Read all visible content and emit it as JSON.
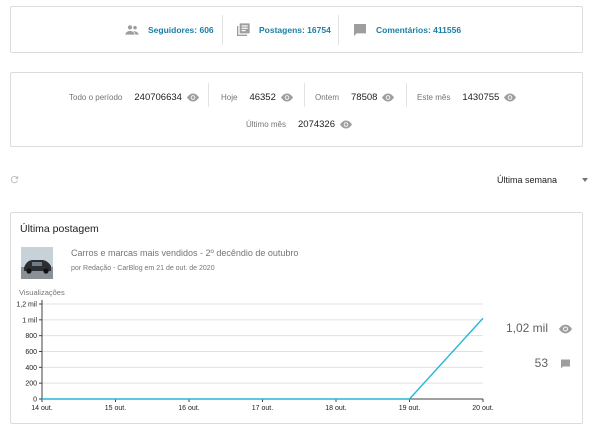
{
  "top": {
    "followers": "Seguidores: 606",
    "posts": "Postagens: 16754",
    "comments": "Comentários: 411556"
  },
  "stats": [
    {
      "label": "Todo o período",
      "value": "240706634"
    },
    {
      "label": "Hoje",
      "value": "46352"
    },
    {
      "label": "Ontem",
      "value": "78508"
    },
    {
      "label": "Este mês",
      "value": "1430755"
    },
    {
      "label": "Último mês",
      "value": "2074326"
    }
  ],
  "toolbar": {
    "range": "Última semana",
    "refresh_icon": "refresh-icon",
    "dropdown_icon": "caret-down-icon"
  },
  "latest_post": {
    "heading": "Última postagem",
    "title": "Carros e marcas mais vendidos - 2º decêndio de outubro",
    "meta": "por Redação - CarBlog em 21 de out. de 2020",
    "views": "1,02 mil",
    "comments": "53"
  },
  "colors": {
    "accent": "#1b7ea5",
    "line": "#29b6d9",
    "axis": "#424242"
  },
  "chart_data": {
    "type": "line",
    "title": "Visualizações",
    "xlabel": "",
    "ylabel": "",
    "categories": [
      "14 out.",
      "15 out.",
      "16 out.",
      "17 out.",
      "18 out.",
      "19 out.",
      "20 out."
    ],
    "ytick_labels": [
      "1,2 mil",
      "1 mil",
      "800",
      "600",
      "400",
      "200",
      "0"
    ],
    "ylim": [
      0,
      1200
    ],
    "grid": true,
    "series": [
      {
        "x": [
          "14 out.",
          "15 out.",
          "16 out.",
          "17 out.",
          "18 out.",
          "19 out.",
          "20 out."
        ],
        "values": [
          0,
          0,
          0,
          0,
          0,
          0,
          1020
        ]
      }
    ]
  }
}
